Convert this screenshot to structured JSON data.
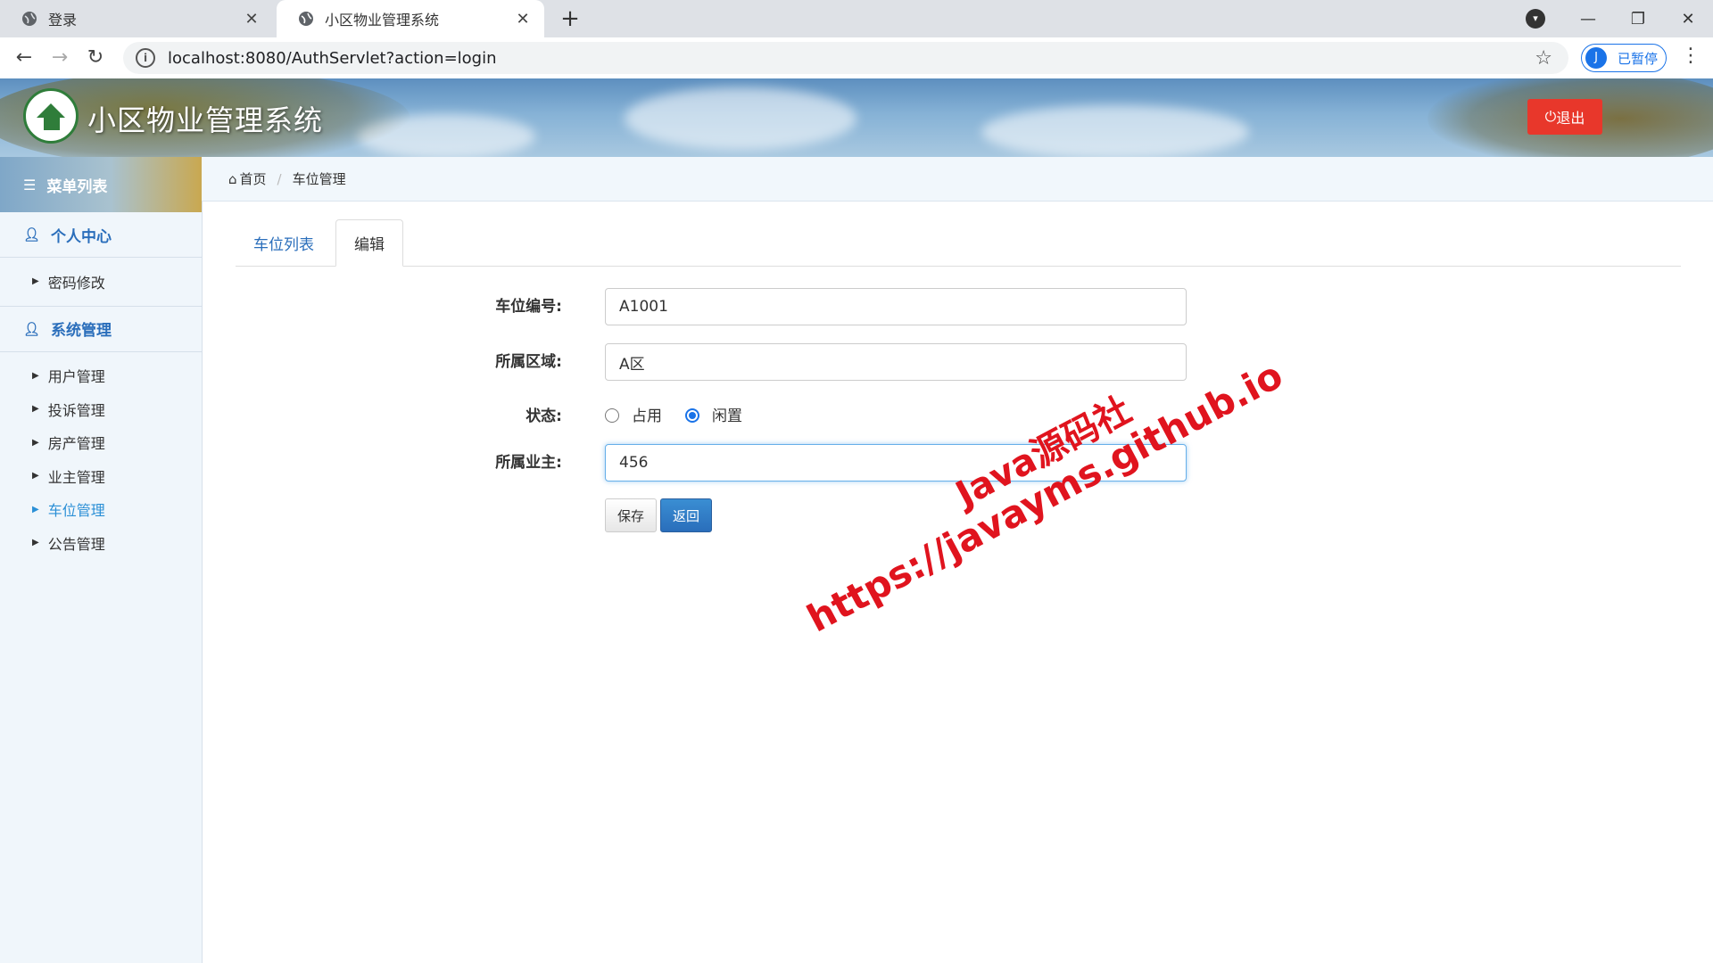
{
  "browser": {
    "tabs": [
      {
        "title": "登录",
        "active": false
      },
      {
        "title": "小区物业管理系统",
        "active": true
      }
    ],
    "url": "localhost:8080/AuthServlet?action=login",
    "profile_initial": "J",
    "profile_status": "已暂停"
  },
  "header": {
    "title": "小区物业管理系统",
    "logout_label": "退出"
  },
  "sidebar": {
    "heading": "菜单列表",
    "groups": [
      {
        "label": "个人中心",
        "items": [
          "密码修改"
        ]
      },
      {
        "label": "系统管理",
        "items": [
          "用户管理",
          "投诉管理",
          "房产管理",
          "业主管理",
          "车位管理",
          "公告管理"
        ]
      }
    ],
    "active_item": "车位管理"
  },
  "breadcrumb": {
    "home": "首页",
    "current": "车位管理"
  },
  "tabs": {
    "list": "车位列表",
    "edit": "编辑"
  },
  "form": {
    "space_no_label": "车位编号:",
    "space_no_value": "A1001",
    "area_label": "所属区域:",
    "area_value": "A区",
    "status_label": "状态:",
    "status_options": [
      "占用",
      "闲置"
    ],
    "status_selected": "闲置",
    "owner_label": "所属业主:",
    "owner_value": "456",
    "save_label": "保存",
    "back_label": "返回"
  },
  "watermark": {
    "line1": "Java源码社",
    "line2": "https://javayms.github.io"
  },
  "colors": {
    "accent": "#2a6ebb",
    "logout": "#e8372b",
    "watermark": "#e0141e"
  }
}
